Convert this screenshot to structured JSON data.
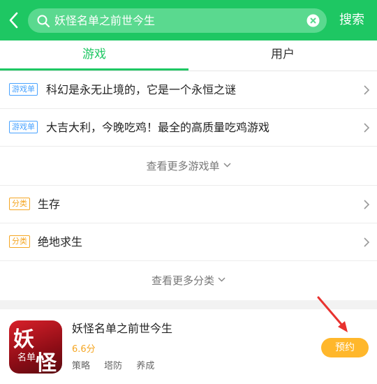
{
  "header": {
    "search_value": "妖怪名单之前世今生",
    "search_button": "搜索",
    "accent_color": "#1ec763"
  },
  "tabs": [
    {
      "label": "游戏",
      "active": true
    },
    {
      "label": "用户",
      "active": false
    }
  ],
  "game_lists": [
    {
      "badge": "游戏单",
      "title": "科幻是永无止境的，它是一个永恒之谜"
    },
    {
      "badge": "游戏单",
      "title": "大吉大利，今晚吃鸡！最全的高质量吃鸡游戏"
    }
  ],
  "more_game_lists": "查看更多游戏单",
  "categories": [
    {
      "badge": "分类",
      "title": "生存"
    },
    {
      "badge": "分类",
      "title": "绝地求生"
    }
  ],
  "more_categories": "查看更多分类",
  "game": {
    "title": "妖怪名单之前世今生",
    "score": "6.6分",
    "tags": [
      "策略",
      "塔防",
      "养成"
    ],
    "action": "预约",
    "icon_text": [
      "妖",
      "怪",
      "名单"
    ]
  },
  "icons": {
    "back": "chevron-left-icon",
    "search": "search-icon",
    "clear": "clear-icon",
    "row_arrow": "chevron-right-icon",
    "expand": "chevron-down-icon",
    "annotation": "red-arrow-icon"
  }
}
